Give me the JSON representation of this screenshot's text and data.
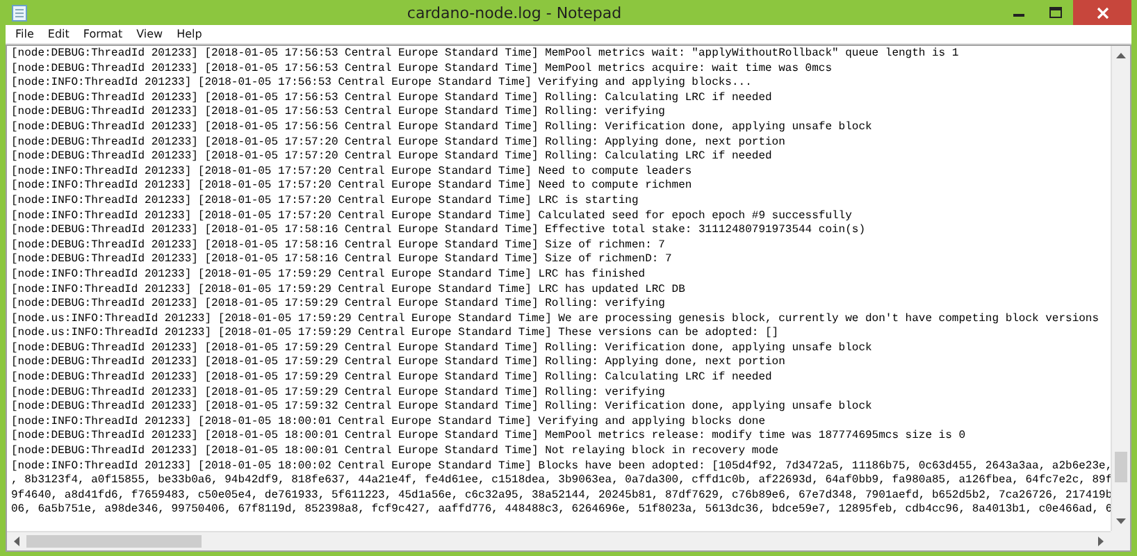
{
  "window": {
    "title": "cardano-node.log - Notepad"
  },
  "menu": [
    "File",
    "Edit",
    "Format",
    "View",
    "Help"
  ],
  "lines": [
    "[node:DEBUG:ThreadId 201233] [2018-01-05 17:56:53 Central Europe Standard Time] MemPool metrics wait: \"applyWithoutRollback\" queue length is 1",
    "[node:DEBUG:ThreadId 201233] [2018-01-05 17:56:53 Central Europe Standard Time] MemPool metrics acquire: wait time was 0mcs",
    "[node:INFO:ThreadId 201233] [2018-01-05 17:56:53 Central Europe Standard Time] Verifying and applying blocks...",
    "[node:DEBUG:ThreadId 201233] [2018-01-05 17:56:53 Central Europe Standard Time] Rolling: Calculating LRC if needed",
    "[node:DEBUG:ThreadId 201233] [2018-01-05 17:56:53 Central Europe Standard Time] Rolling: verifying",
    "[node:DEBUG:ThreadId 201233] [2018-01-05 17:56:56 Central Europe Standard Time] Rolling: Verification done, applying unsafe block",
    "[node:DEBUG:ThreadId 201233] [2018-01-05 17:57:20 Central Europe Standard Time] Rolling: Applying done, next portion",
    "[node:DEBUG:ThreadId 201233] [2018-01-05 17:57:20 Central Europe Standard Time] Rolling: Calculating LRC if needed",
    "[node:INFO:ThreadId 201233] [2018-01-05 17:57:20 Central Europe Standard Time] Need to compute leaders",
    "[node:INFO:ThreadId 201233] [2018-01-05 17:57:20 Central Europe Standard Time] Need to compute richmen",
    "[node:INFO:ThreadId 201233] [2018-01-05 17:57:20 Central Europe Standard Time] LRC is starting",
    "[node:INFO:ThreadId 201233] [2018-01-05 17:57:20 Central Europe Standard Time] Calculated seed for epoch epoch #9 successfully",
    "[node:DEBUG:ThreadId 201233] [2018-01-05 17:58:16 Central Europe Standard Time] Effective total stake: 31112480791973544 coin(s)",
    "[node:DEBUG:ThreadId 201233] [2018-01-05 17:58:16 Central Europe Standard Time] Size of richmen: 7",
    "[node:DEBUG:ThreadId 201233] [2018-01-05 17:58:16 Central Europe Standard Time] Size of richmenD: 7",
    "[node:INFO:ThreadId 201233] [2018-01-05 17:59:29 Central Europe Standard Time] LRC has finished",
    "[node:INFO:ThreadId 201233] [2018-01-05 17:59:29 Central Europe Standard Time] LRC has updated LRC DB",
    "[node:DEBUG:ThreadId 201233] [2018-01-05 17:59:29 Central Europe Standard Time] Rolling: verifying",
    "[node.us:INFO:ThreadId 201233] [2018-01-05 17:59:29 Central Europe Standard Time] We are processing genesis block, currently we don't have competing block versions",
    "[node.us:INFO:ThreadId 201233] [2018-01-05 17:59:29 Central Europe Standard Time] These versions can be adopted: []",
    "[node:DEBUG:ThreadId 201233] [2018-01-05 17:59:29 Central Europe Standard Time] Rolling: Verification done, applying unsafe block",
    "[node:DEBUG:ThreadId 201233] [2018-01-05 17:59:29 Central Europe Standard Time] Rolling: Applying done, next portion",
    "[node:DEBUG:ThreadId 201233] [2018-01-05 17:59:29 Central Europe Standard Time] Rolling: Calculating LRC if needed",
    "[node:DEBUG:ThreadId 201233] [2018-01-05 17:59:29 Central Europe Standard Time] Rolling: verifying",
    "[node:DEBUG:ThreadId 201233] [2018-01-05 17:59:32 Central Europe Standard Time] Rolling: Verification done, applying unsafe block",
    "[node:INFO:ThreadId 201233] [2018-01-05 18:00:01 Central Europe Standard Time] Verifying and applying blocks done",
    "[node:DEBUG:ThreadId 201233] [2018-01-05 18:00:01 Central Europe Standard Time] MemPool metrics release: modify time was 187774695mcs size is 0",
    "[node:DEBUG:ThreadId 201233] [2018-01-05 18:00:01 Central Europe Standard Time] Not relaying block in recovery mode",
    "[node:INFO:ThreadId 201233] [2018-01-05 18:00:02 Central Europe Standard Time] Blocks have been adopted: [105d4f92, 7d3472a5, 11186b75, 0c63d455, 2643a3aa, a2b6e23e,",
    ", 8b3123f4, a0f15855, be33b0a6, 94b42df9, 818fe637, 44a21e4f, fe4d61ee, c1518dea, 3b9063ea, 0a7da300, cffd1c0b, af22693d, 64af0bb9, fa980a85, a126fbea, 64fc7e2c, 89f",
    "9f4640, a8d41fd6, f7659483, c50e05e4, de761933, 5f611223, 45d1a56e, c6c32a95, 38a52144, 20245b81, 87df7629, c76b89e6, 67e7d348, 7901aefd, b652d5b2, 7ca26726, 217419b",
    "06, 6a5b751e, a98de346, 99750406, 67f8119d, 852398a8, fcf9c427, aaffd776, 448488c3, 6264696e, 51f8023a, 5613dc36, bdce59e7, 12895feb, cdb4cc96, 8a4013b1, c0e466ad, 6"
  ]
}
